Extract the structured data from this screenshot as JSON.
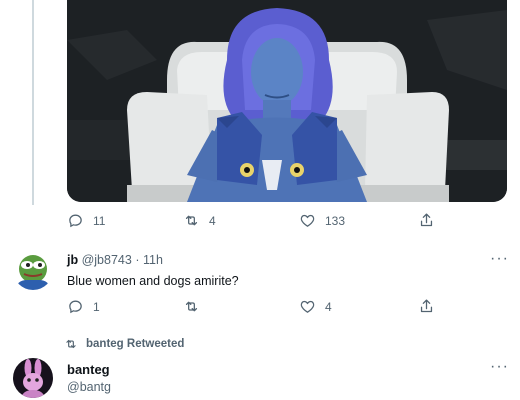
{
  "top_tweet": {
    "image_alt": "Blue-painted figure seated with a blue dog sweater",
    "stats": {
      "reply_count": "11",
      "retweet_count": "4",
      "like_count": "133"
    }
  },
  "reply_tweet": {
    "display_name": "jb",
    "handle": "@jb8743",
    "separator": "·",
    "time": "11h",
    "text": "Blue women and dogs amirite?",
    "stats": {
      "reply_count": "1",
      "retweet_count": "",
      "like_count": "4"
    }
  },
  "retweet_tweet": {
    "retweeted_by": "banteg Retweeted",
    "display_name": "banteg",
    "handle": "@bantg"
  },
  "icons": {
    "reply": "reply-icon",
    "retweet": "retweet-icon",
    "like": "heart-icon",
    "share": "share-icon",
    "more": "more-icon"
  },
  "colors": {
    "secondary_text": "#536471",
    "thread_line": "#cfd9de",
    "primary_text": "#0f1419"
  }
}
